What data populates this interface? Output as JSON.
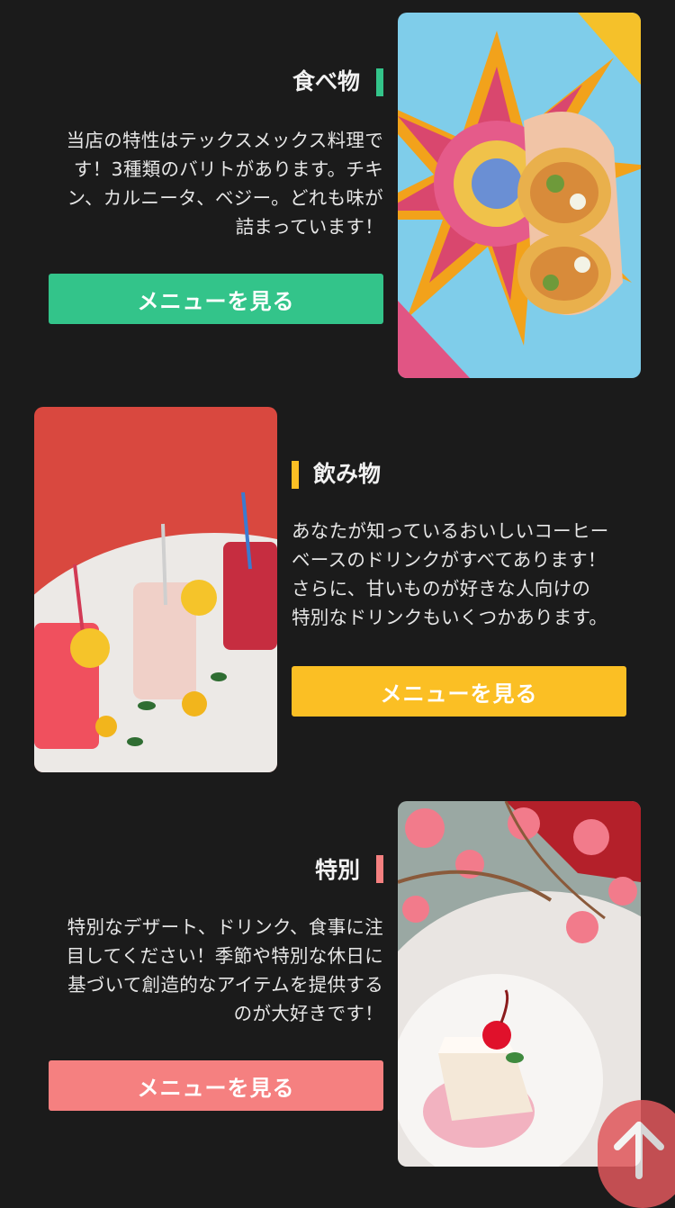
{
  "sections": [
    {
      "title": "食べ物",
      "description_lines": [
        "当店の特性はテックスメックス料理で",
        "す！3種類のバリトがあります。チキ",
        "ン、カルニータ、ベジー。どれも味が",
        "詰まっています！"
      ],
      "button_label": "メニューを見る",
      "accent": "#33c48a",
      "photo": "burrito-photo"
    },
    {
      "title": "飲み物",
      "description_lines": [
        "あなたが知っているおいしいコーヒー",
        "ベースのドリンクがすべてあります！",
        "さらに、甘いものが好きな人向けの",
        "特別なドリンクもいくつかあります。"
      ],
      "button_label": "メニューを見る",
      "accent": "#fbbf24",
      "photo": "drinks-photo"
    },
    {
      "title": "特別",
      "description_lines": [
        "特別なデザート、ドリンク、食事に注",
        "目してください！季節や特別な休日に",
        "基づいて創造的なアイテムを提供する",
        "のが大好きです！"
      ],
      "button_label": "メニューを見る",
      "accent": "#f58080",
      "photo": "dessert-photo"
    }
  ],
  "scroll_top": {
    "icon": "arrow-up-icon",
    "color": "#e0585c"
  }
}
